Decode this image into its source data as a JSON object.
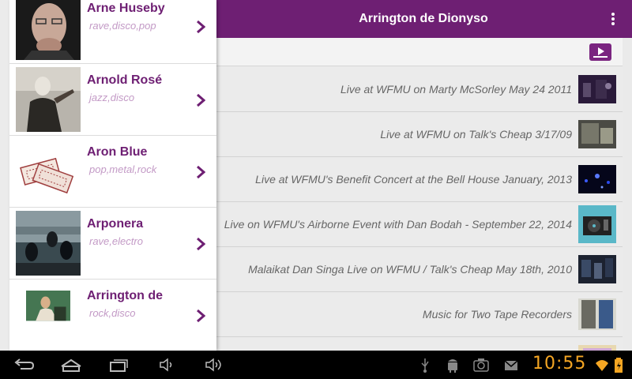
{
  "appbar": {
    "title": "Arrington de Dionyso"
  },
  "artists": [
    {
      "name": "Arne Huseby",
      "genres": "rave,disco,pop"
    },
    {
      "name": "Arnold Rosé",
      "genres": "jazz,disco"
    },
    {
      "name": "Aron Blue",
      "genres": "pop,metal,rock"
    },
    {
      "name": "Arponera",
      "genres": "rave,electro"
    },
    {
      "name": "Arrington de",
      "genres": "rock,disco"
    }
  ],
  "videos": [
    {
      "title": "Live at WFMU on Marty McSorley May 24 2011"
    },
    {
      "title": "Live at WFMU on Talk's Cheap 3/17/09"
    },
    {
      "title": "Live at WFMU's Benefit Concert at the Bell House January, 2013"
    },
    {
      "title": "Live on WFMU's Airborne Event with Dan Bodah - September 22, 2014"
    },
    {
      "title": "Malaikat Dan Singa Live on WFMU / Talk's Cheap May 18th, 2010"
    },
    {
      "title": "Music for Two Tape Recorders"
    }
  ],
  "status": {
    "time": "10:55"
  },
  "colors": {
    "accent": "#6e1f73",
    "genre": "#c39ac6",
    "clock": "#f5a623"
  }
}
